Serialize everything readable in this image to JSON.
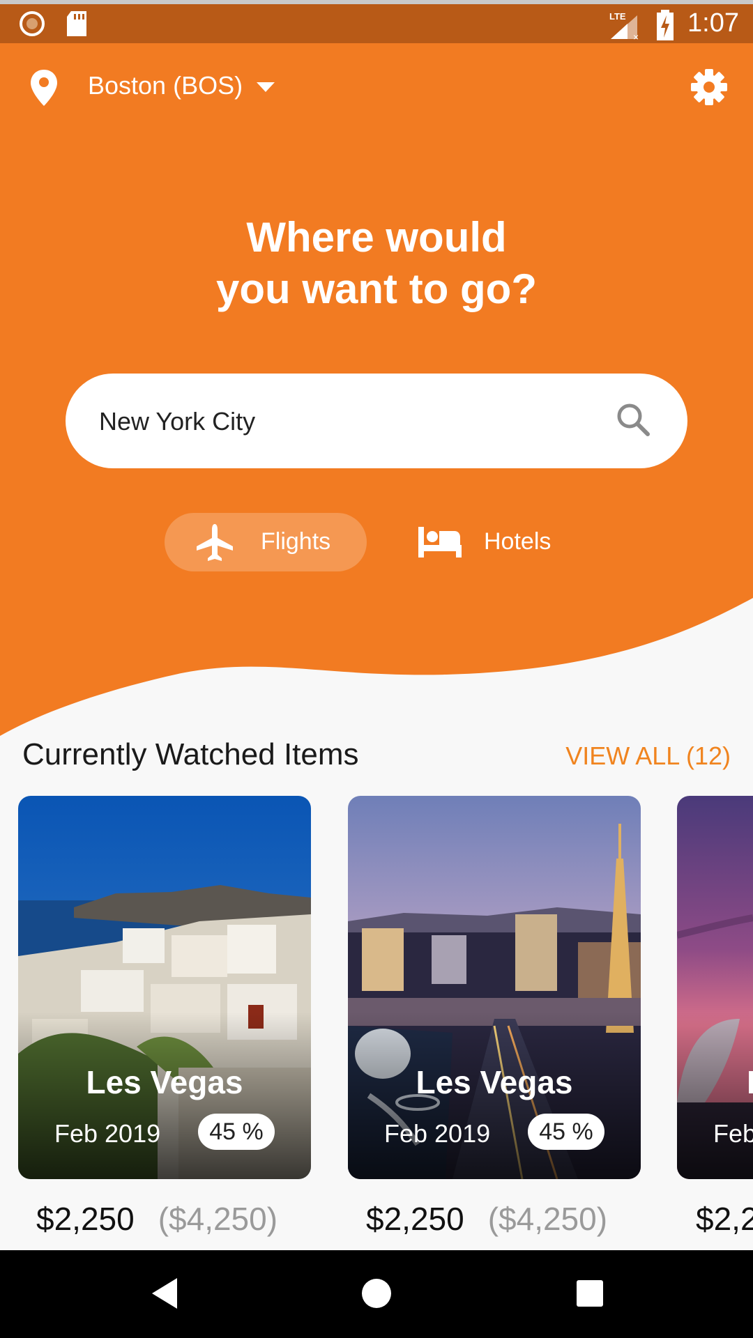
{
  "status_bar": {
    "time": "1:07",
    "icons": [
      "record-icon",
      "sd-card-icon",
      "lte-signal-icon",
      "battery-charging-icon"
    ]
  },
  "header": {
    "location": "Boston (BOS)",
    "location_icon": "map-pin-icon",
    "settings_icon": "gear-icon"
  },
  "hero": {
    "headline_line1": "Where would",
    "headline_line2": "you want to go?"
  },
  "search": {
    "value": "New York City",
    "icon": "search-icon"
  },
  "tabs": [
    {
      "label": "Flights",
      "icon": "airplane-icon",
      "selected": true
    },
    {
      "label": "Hotels",
      "icon": "bed-icon",
      "selected": false
    }
  ],
  "section": {
    "title": "Currently Watched Items",
    "view_all": "VIEW ALL (12)"
  },
  "cards": [
    {
      "title": "Les Vegas",
      "date": "Feb 2019",
      "discount": "45 %",
      "price": "$2,250",
      "original_price": "($4,250)"
    },
    {
      "title": "Les Vegas",
      "date": "Feb 2019",
      "discount": "45 %",
      "price": "$2,250",
      "original_price": "($4,250)"
    },
    {
      "title": "L",
      "date": "Feb",
      "discount": "",
      "price": "$2,2",
      "original_price": ""
    }
  ],
  "nav": {
    "icons": [
      "back-icon",
      "home-icon",
      "recents-icon"
    ]
  },
  "colors": {
    "brand_orange": "#f27b22",
    "status_bar": "#b85a17",
    "accent_link": "#f0841f",
    "background": "#f8f8f8"
  }
}
